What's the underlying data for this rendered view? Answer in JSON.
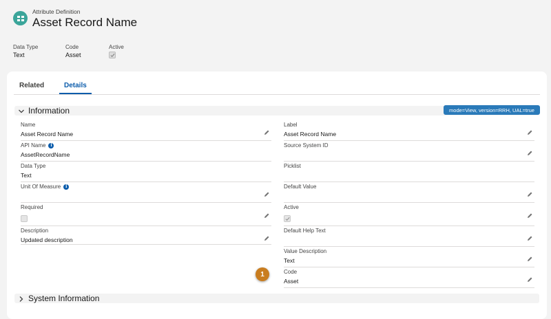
{
  "header": {
    "object_type": "Attribute Definition",
    "record_name": "Asset Record Name",
    "highlights": [
      {
        "label": "Data Type",
        "value": "Text"
      },
      {
        "label": "Code",
        "value": "Asset"
      },
      {
        "label": "Active",
        "checked": true
      }
    ]
  },
  "tabs": [
    {
      "label": "Related",
      "active": false
    },
    {
      "label": "Details",
      "active": true
    }
  ],
  "information": {
    "title": "Information",
    "badge": "mode=View, version=RRH, UAL=true",
    "left": {
      "name": {
        "label": "Name",
        "value": "Asset Record Name"
      },
      "api_name": {
        "label": "API Name",
        "value": "AssetRecordName"
      },
      "data_type": {
        "label": "Data Type",
        "value": "Text"
      },
      "unit_of_measure": {
        "label": "Unit Of Measure",
        "value": ""
      },
      "required": {
        "label": "Required",
        "checked": false
      },
      "description": {
        "label": "Description",
        "value": "Updated description"
      }
    },
    "right": {
      "label": {
        "label": "Label",
        "value": "Asset Record Name"
      },
      "source_system_id": {
        "label": "Source System ID",
        "value": ""
      },
      "picklist": {
        "label": "Picklist",
        "value": ""
      },
      "default_value": {
        "label": "Default Value",
        "value": ""
      },
      "active": {
        "label": "Active",
        "checked": true
      },
      "default_help_text": {
        "label": "Default Help Text",
        "value": ""
      },
      "value_description": {
        "label": "Value Description",
        "value": "Text"
      },
      "code": {
        "label": "Code",
        "value": "Asset"
      }
    }
  },
  "system_information": {
    "title": "System Information"
  },
  "step_marker": "1",
  "colors": {
    "accent": "#0b5cab",
    "badge": "#2a7ab9",
    "icon_bg": "#3ba59a",
    "marker": "#c97d1f"
  }
}
